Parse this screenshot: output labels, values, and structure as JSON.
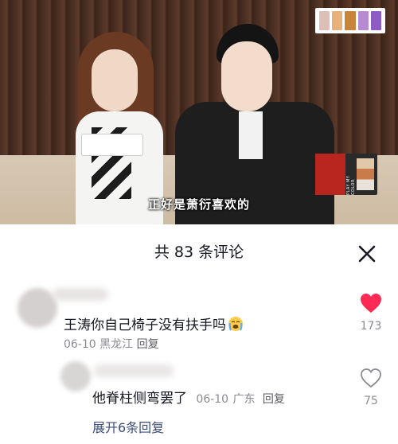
{
  "video": {
    "subtitle": "正好是萧衍喜欢的",
    "palette_colors": [
      "#dcbfb7",
      "#e8b07a",
      "#c8843a",
      "#b98ad4",
      "#8c5cc4"
    ],
    "book_text": "PLAY MY COLOR"
  },
  "comments_panel": {
    "title": "共 83 条评论",
    "close_icon": "close-icon"
  },
  "comments": [
    {
      "text": "王涛你自己椅子没有扶手吗",
      "emoji": "crying-face-emoji",
      "date": "06-10",
      "location": "黑龙江",
      "reply_label": "回复",
      "likes": "173",
      "liked": true,
      "like_color": "#fe2c55"
    },
    {
      "text": "他脊柱侧弯罢了",
      "date": "06-10",
      "location": "广东",
      "reply_label": "回复",
      "likes": "75",
      "liked": false
    }
  ],
  "expand_replies_label": "展开6条回复"
}
